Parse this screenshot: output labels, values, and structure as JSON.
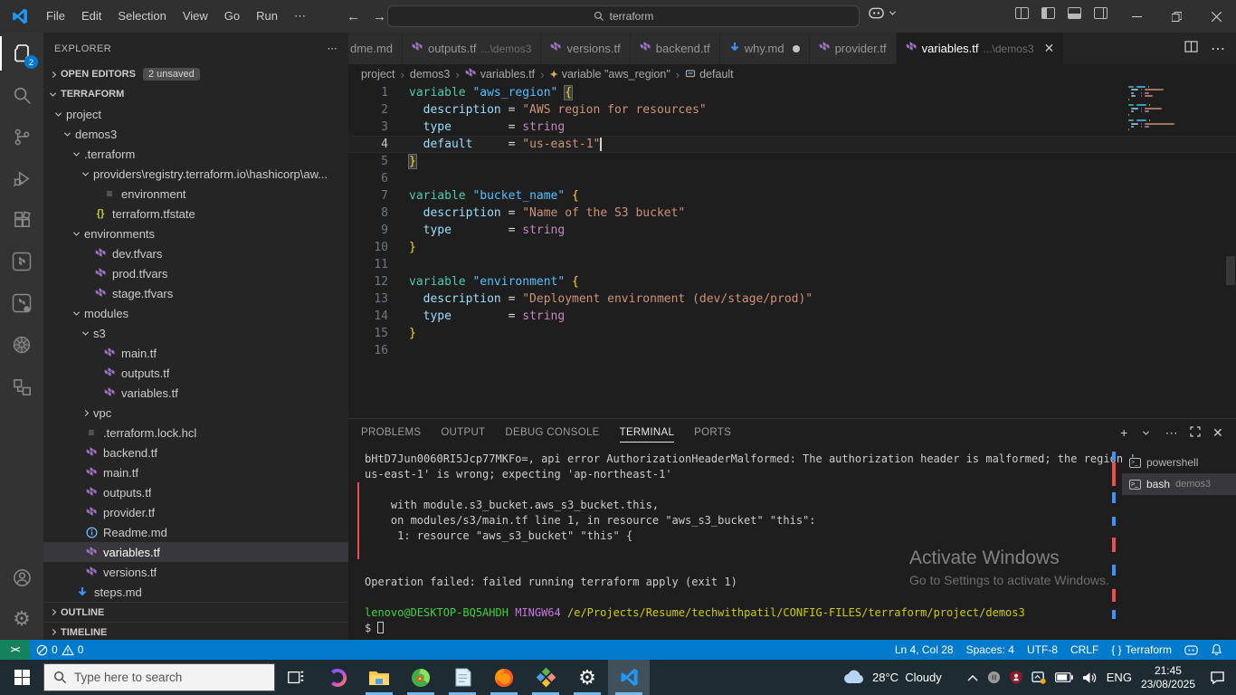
{
  "window": {
    "menus": [
      "File",
      "Edit",
      "Selection",
      "View",
      "Go",
      "Run",
      "⋯"
    ],
    "command_center_query": "terraform",
    "controls": {
      "minimize": "minimize",
      "restore": "restore",
      "close": "close"
    }
  },
  "activity_bar": {
    "badge": "2",
    "items": [
      "explorer",
      "search",
      "source-control",
      "run-debug",
      "extensions",
      "terraform",
      "terraform-cloud",
      "kubernetes",
      "remote-explorer"
    ],
    "bottom_items": [
      "account",
      "settings"
    ]
  },
  "sidebar": {
    "title": "EXPLORER",
    "open_editors": {
      "label": "OPEN EDITORS",
      "badge": "2 unsaved"
    },
    "workspace_label": "TERRAFORM",
    "tree": [
      {
        "lvl": 0,
        "chev": "down",
        "icon": "",
        "label": "project"
      },
      {
        "lvl": 1,
        "chev": "down",
        "icon": "",
        "label": "demos3"
      },
      {
        "lvl": 2,
        "chev": "down",
        "icon": "",
        "label": ".terraform"
      },
      {
        "lvl": 3,
        "chev": "down",
        "icon": "",
        "label": "providers\\registry.terraform.io\\hashicorp\\aw..."
      },
      {
        "lvl": 4,
        "chev": "",
        "icon": "lines",
        "label": "environment"
      },
      {
        "lvl": 3,
        "chev": "",
        "icon": "braces",
        "label": "terraform.tfstate"
      },
      {
        "lvl": 2,
        "chev": "down",
        "icon": "",
        "label": "environments"
      },
      {
        "lvl": 3,
        "chev": "",
        "icon": "tf",
        "label": "dev.tfvars"
      },
      {
        "lvl": 3,
        "chev": "",
        "icon": "tf",
        "label": "prod.tfvars"
      },
      {
        "lvl": 3,
        "chev": "",
        "icon": "tf",
        "label": "stage.tfvars"
      },
      {
        "lvl": 2,
        "chev": "down",
        "icon": "",
        "label": "modules"
      },
      {
        "lvl": 3,
        "chev": "down",
        "icon": "",
        "label": "s3"
      },
      {
        "lvl": 4,
        "chev": "",
        "icon": "tf",
        "label": "main.tf"
      },
      {
        "lvl": 4,
        "chev": "",
        "icon": "tf",
        "label": "outputs.tf"
      },
      {
        "lvl": 4,
        "chev": "",
        "icon": "tf",
        "label": "variables.tf"
      },
      {
        "lvl": 3,
        "chev": "right",
        "icon": "",
        "label": "vpc"
      },
      {
        "lvl": 2,
        "chev": "",
        "icon": "lines",
        "label": ".terraform.lock.hcl"
      },
      {
        "lvl": 2,
        "chev": "",
        "icon": "tf",
        "label": "backend.tf"
      },
      {
        "lvl": 2,
        "chev": "",
        "icon": "tf",
        "label": "main.tf"
      },
      {
        "lvl": 2,
        "chev": "",
        "icon": "tf",
        "label": "outputs.tf"
      },
      {
        "lvl": 2,
        "chev": "",
        "icon": "tf",
        "label": "provider.tf"
      },
      {
        "lvl": 2,
        "chev": "",
        "icon": "info",
        "label": "Readme.md"
      },
      {
        "lvl": 2,
        "chev": "",
        "icon": "tf",
        "label": "variables.tf",
        "selected": true
      },
      {
        "lvl": 2,
        "chev": "",
        "icon": "tf",
        "label": "versions.tf"
      },
      {
        "lvl": 1,
        "chev": "",
        "icon": "mddown",
        "label": "steps.md"
      }
    ],
    "bottom_sections": [
      "OUTLINE",
      "TIMELINE"
    ]
  },
  "tabs": [
    {
      "label": "dme.md",
      "icon": "",
      "dir": "",
      "clipped": true
    },
    {
      "label": "outputs.tf",
      "icon": "tf",
      "dir": "...\\demos3"
    },
    {
      "label": "versions.tf",
      "icon": "tf",
      "dir": ""
    },
    {
      "label": "backend.tf",
      "icon": "tf",
      "dir": ""
    },
    {
      "label": "why.md",
      "icon": "mddown",
      "dir": "",
      "modified": true
    },
    {
      "label": "provider.tf",
      "icon": "tf",
      "dir": ""
    },
    {
      "label": "variables.tf",
      "icon": "tf",
      "dir": "...\\demos3",
      "active": true,
      "closable": true
    }
  ],
  "breadcrumbs": [
    {
      "label": "project",
      "icon": ""
    },
    {
      "label": "demos3",
      "icon": ""
    },
    {
      "label": "variables.tf",
      "icon": "tf"
    },
    {
      "label": "variable \"aws_region\"",
      "icon": "symbol"
    },
    {
      "label": "default",
      "icon": "field"
    }
  ],
  "editor": {
    "lines": [
      {
        "n": 1,
        "tokens": [
          [
            "k",
            "variable"
          ],
          [
            "w",
            " "
          ],
          [
            "n",
            "\"aws_region\""
          ],
          [
            "w",
            " "
          ],
          [
            "bm",
            "{"
          ]
        ]
      },
      {
        "n": 2,
        "tokens": [
          [
            "w",
            "  "
          ],
          [
            "p",
            "description"
          ],
          [
            "w",
            " "
          ],
          [
            "o",
            "="
          ],
          [
            "w",
            " "
          ],
          [
            "s",
            "\"AWS region for resources\""
          ]
        ]
      },
      {
        "n": 3,
        "tokens": [
          [
            "w",
            "  "
          ],
          [
            "p",
            "type"
          ],
          [
            "w",
            "        "
          ],
          [
            "o",
            "="
          ],
          [
            "w",
            " "
          ],
          [
            "t",
            "string"
          ]
        ]
      },
      {
        "n": 4,
        "active": true,
        "cursor": true,
        "tokens": [
          [
            "w",
            "  "
          ],
          [
            "p",
            "default"
          ],
          [
            "w",
            "     "
          ],
          [
            "o",
            "="
          ],
          [
            "w",
            " "
          ],
          [
            "s",
            "\"us-east-1\""
          ]
        ]
      },
      {
        "n": 5,
        "tokens": [
          [
            "bm",
            "}"
          ]
        ]
      },
      {
        "n": 6,
        "tokens": []
      },
      {
        "n": 7,
        "tokens": [
          [
            "k",
            "variable"
          ],
          [
            "w",
            " "
          ],
          [
            "n",
            "\"bucket_name\""
          ],
          [
            "w",
            " "
          ],
          [
            "b",
            "{"
          ]
        ]
      },
      {
        "n": 8,
        "tokens": [
          [
            "w",
            "  "
          ],
          [
            "p",
            "description"
          ],
          [
            "w",
            " "
          ],
          [
            "o",
            "="
          ],
          [
            "w",
            " "
          ],
          [
            "s",
            "\"Name of the S3 bucket\""
          ]
        ]
      },
      {
        "n": 9,
        "tokens": [
          [
            "w",
            "  "
          ],
          [
            "p",
            "type"
          ],
          [
            "w",
            "        "
          ],
          [
            "o",
            "="
          ],
          [
            "w",
            " "
          ],
          [
            "t",
            "string"
          ]
        ]
      },
      {
        "n": 10,
        "tokens": [
          [
            "b",
            "}"
          ]
        ]
      },
      {
        "n": 11,
        "tokens": []
      },
      {
        "n": 12,
        "tokens": [
          [
            "k",
            "variable"
          ],
          [
            "w",
            " "
          ],
          [
            "n",
            "\"environment\""
          ],
          [
            "w",
            " "
          ],
          [
            "b",
            "{"
          ]
        ]
      },
      {
        "n": 13,
        "tokens": [
          [
            "w",
            "  "
          ],
          [
            "p",
            "description"
          ],
          [
            "w",
            " "
          ],
          [
            "o",
            "="
          ],
          [
            "w",
            " "
          ],
          [
            "s",
            "\"Deployment environment (dev/stage/prod)\""
          ]
        ]
      },
      {
        "n": 14,
        "tokens": [
          [
            "w",
            "  "
          ],
          [
            "p",
            "type"
          ],
          [
            "w",
            "        "
          ],
          [
            "o",
            "="
          ],
          [
            "w",
            " "
          ],
          [
            "t",
            "string"
          ]
        ]
      },
      {
        "n": 15,
        "tokens": [
          [
            "b",
            "}"
          ]
        ]
      },
      {
        "n": 16,
        "tokens": []
      }
    ]
  },
  "panel": {
    "tabs": [
      {
        "label": "PROBLEMS"
      },
      {
        "label": "OUTPUT"
      },
      {
        "label": "DEBUG CONSOLE"
      },
      {
        "label": "TERMINAL",
        "active": true
      },
      {
        "label": "PORTS"
      }
    ],
    "terminals": [
      {
        "label": "powershell",
        "detail": "",
        "active": false
      },
      {
        "label": "bash",
        "detail": "demos3",
        "active": true
      }
    ],
    "terminal_lines": [
      {
        "bar": false,
        "seg": [
          [
            "w",
            "bHtD7Jun0060RI5Jcp77MKFo=, api error AuthorizationHeaderMalformed: The authorization header is malformed; the region '"
          ]
        ]
      },
      {
        "bar": false,
        "seg": [
          [
            "w",
            "us-east-1' is wrong; expecting 'ap-northeast-1'"
          ]
        ]
      },
      {
        "bar": true,
        "seg": []
      },
      {
        "bar": true,
        "seg": [
          [
            "w",
            "    with module.s3_bucket.aws_s3_bucket.this,"
          ]
        ]
      },
      {
        "bar": true,
        "seg": [
          [
            "w",
            "    on modules/s3/main.tf line 1, in resource \"aws_s3_bucket\" \"this\":"
          ]
        ]
      },
      {
        "bar": true,
        "seg": [
          [
            "w",
            "     1: resource \"aws_s3_bucket\" \"this\" {"
          ]
        ]
      },
      {
        "bar": true,
        "seg": []
      },
      {
        "bar": false,
        "seg": []
      },
      {
        "bar": false,
        "seg": [
          [
            "w",
            "Operation failed: failed running terraform apply (exit 1)"
          ]
        ]
      },
      {
        "bar": false,
        "seg": []
      },
      {
        "bar": false,
        "seg": [
          [
            "green",
            "lenovo@DESKTOP-BQ5AHDH"
          ],
          [
            "w",
            " "
          ],
          [
            "mag",
            "MINGW64"
          ],
          [
            "w",
            " "
          ],
          [
            "yel",
            "/e/Projects/Resume/techwithpatil/CONFIG-FILES/terraform/project/demos3"
          ]
        ]
      },
      {
        "bar": false,
        "seg": [
          [
            "w",
            "$ "
          ],
          [
            "cursor",
            ""
          ]
        ]
      }
    ],
    "watermark": {
      "line1": "Activate Windows",
      "line2": "Go to Settings to activate Windows."
    }
  },
  "status_bar": {
    "errors": "0",
    "warnings": "0",
    "cursor_position": "Ln 4, Col 28",
    "indentation": "Spaces: 4",
    "encoding": "UTF-8",
    "eol": "CRLF",
    "language_icon": "{ }",
    "language": "Terraform"
  },
  "taskbar": {
    "search_placeholder": "Type here to search",
    "apps": [
      {
        "name": "task-view",
        "running": false
      },
      {
        "name": "copilot",
        "running": false
      },
      {
        "name": "file-explorer",
        "running": true
      },
      {
        "name": "idm",
        "running": true
      },
      {
        "name": "notepad",
        "running": true
      },
      {
        "name": "firefox",
        "running": true
      },
      {
        "name": "diamond-app",
        "running": true
      },
      {
        "name": "settings",
        "running": true
      },
      {
        "name": "vscode",
        "running": true,
        "focused": true
      }
    ],
    "weather_temp": "28°C",
    "weather_text": "Cloudy",
    "language": "ENG",
    "time": "21:45",
    "date": "23/08/2025"
  },
  "colors": {
    "statusbar": "#007ACC",
    "remote": "#16825D",
    "terraform_purple": "#A074C4",
    "error_red": "#f14c4c",
    "info_blue": "#3794ff"
  }
}
